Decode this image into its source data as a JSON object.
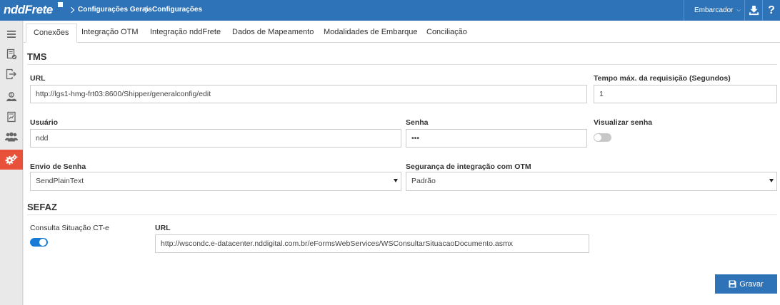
{
  "topbar": {
    "logo": "nddFrete",
    "breadcrumb": [
      "Configurações Gerais",
      "Configurações"
    ],
    "user": "Embarcador"
  },
  "sidebar": {
    "icons": [
      "menu-icon",
      "document-check-icon",
      "exit-icon",
      "person-money-icon",
      "report-icon",
      "users-icon",
      "gears-icon"
    ],
    "active": "gears-icon"
  },
  "tabs": [
    "Conexões",
    "Integração OTM",
    "Integração nddFrete",
    "Dados de Mapeamento",
    "Modalidades de Embarque",
    "Conciliação"
  ],
  "active_tab": "Conexões",
  "tms": {
    "title": "TMS",
    "url_label": "URL",
    "url_value": "http://lgs1-hmg-frt03:8600/Shipper/generalconfig/edit",
    "timeout_label": "Tempo máx. da requisição (Segundos)",
    "timeout_value": "1",
    "user_label": "Usuário",
    "user_value": "ndd",
    "password_label": "Senha",
    "password_value": "•••",
    "show_password_label": "Visualizar senha",
    "show_password_on": false,
    "send_password_label": "Envio de Senha",
    "send_password_value": "SendPlainText",
    "otm_security_label": "Segurança de integração com OTM",
    "otm_security_value": "Padrão"
  },
  "sefaz": {
    "title": "SEFAZ",
    "cte_label": "Consulta Situação CT-e",
    "cte_on": true,
    "url_label": "URL",
    "url_value": "http://wscondc.e-datacenter.nddigital.com.br/eFormsWebServices/WSConsultarSituacaoDocumento.asmx"
  },
  "save_label": "Gravar"
}
